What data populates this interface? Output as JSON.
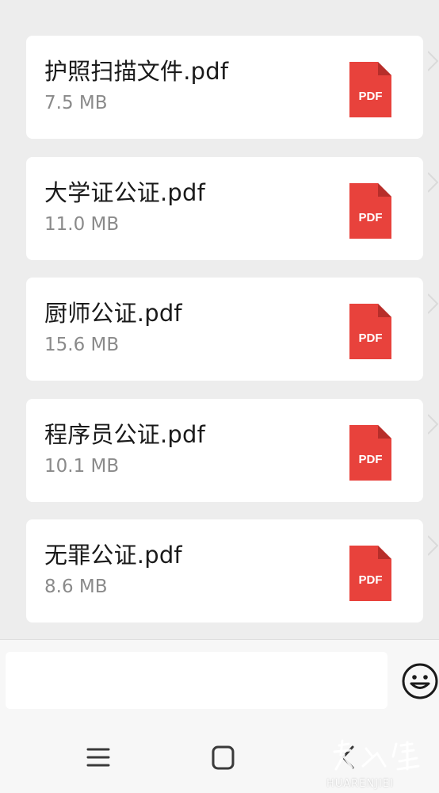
{
  "files": [
    {
      "name": "护照扫描文件.pdf",
      "size": "7.5 MB",
      "icon_label": "PDF"
    },
    {
      "name": "大学证公证.pdf",
      "size": "11.0 MB",
      "icon_label": "PDF"
    },
    {
      "name": "厨师公证.pdf",
      "size": "15.6 MB",
      "icon_label": "PDF"
    },
    {
      "name": "程序员公证.pdf",
      "size": "10.1 MB",
      "icon_label": "PDF"
    },
    {
      "name": "无罪公证.pdf",
      "size": "8.6 MB",
      "icon_label": "PDF"
    }
  ],
  "input": {
    "value": "",
    "placeholder": ""
  },
  "icons": {
    "file": "pdf-file-icon",
    "emoji": "smiley-emoji-icon",
    "nav_menu": "hamburger-menu-icon",
    "nav_home": "rounded-square-home-icon",
    "nav_back": "chevron-left-back-icon"
  },
  "colors": {
    "background": "#ededed",
    "card": "#ffffff",
    "pdf_red": "#e8423c",
    "pdf_fold": "#b72e2a",
    "file_name": "#1a1a1a",
    "file_size": "#8a8a8a"
  },
  "watermark": {
    "text": "HUARENJIEI"
  }
}
